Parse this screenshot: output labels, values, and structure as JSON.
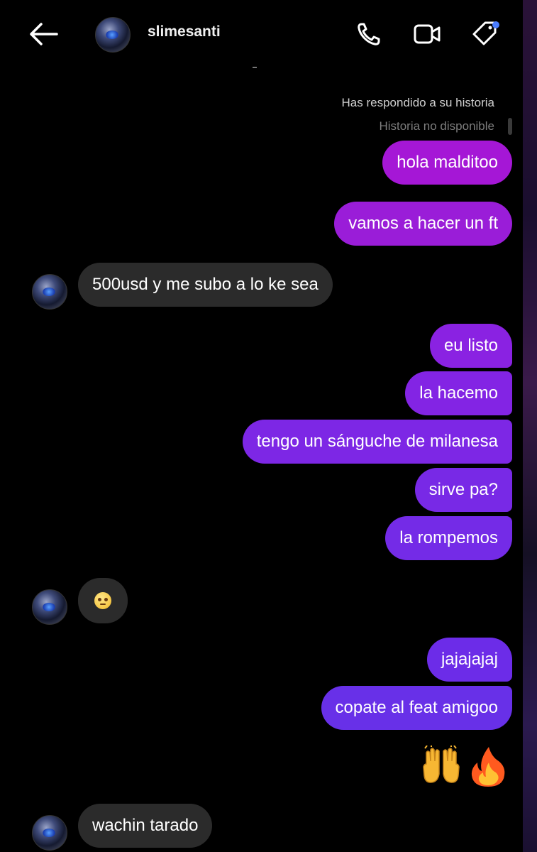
{
  "header": {
    "username": "slimesanti",
    "icons": [
      "back-arrow-icon",
      "phone-icon",
      "video-camera-icon",
      "tag-icon"
    ],
    "accent": "#4a7dff"
  },
  "story": {
    "replied": "Has respondido a su historia",
    "unavailable": "Historia no disponible"
  },
  "messages": [
    {
      "from": "me",
      "text": "hola malditoo"
    },
    {
      "from": "me",
      "text": "vamos a hacer un ft"
    },
    {
      "from": "them",
      "text": "500usd y me subo a lo ke sea"
    },
    {
      "from": "me",
      "text": "eu listo"
    },
    {
      "from": "me",
      "text": "la hacemo"
    },
    {
      "from": "me",
      "text": "tengo un sánguche de milanesa"
    },
    {
      "from": "me",
      "text": "sirve pa?"
    },
    {
      "from": "me",
      "text": "la rompemos"
    },
    {
      "from": "them",
      "emoji": "flushed-face"
    },
    {
      "from": "me",
      "text": "jajajajaj"
    },
    {
      "from": "me",
      "text": "copate al feat amigoo"
    },
    {
      "from": "me",
      "emoji": [
        "raising-hands",
        "fire"
      ]
    },
    {
      "from": "them",
      "text": "wachin tarado"
    }
  ],
  "colors": {
    "incoming_bubble": "#2b2b2b",
    "outgoing_top": "#a517d6",
    "outgoing_bottom": "#6830e8"
  }
}
